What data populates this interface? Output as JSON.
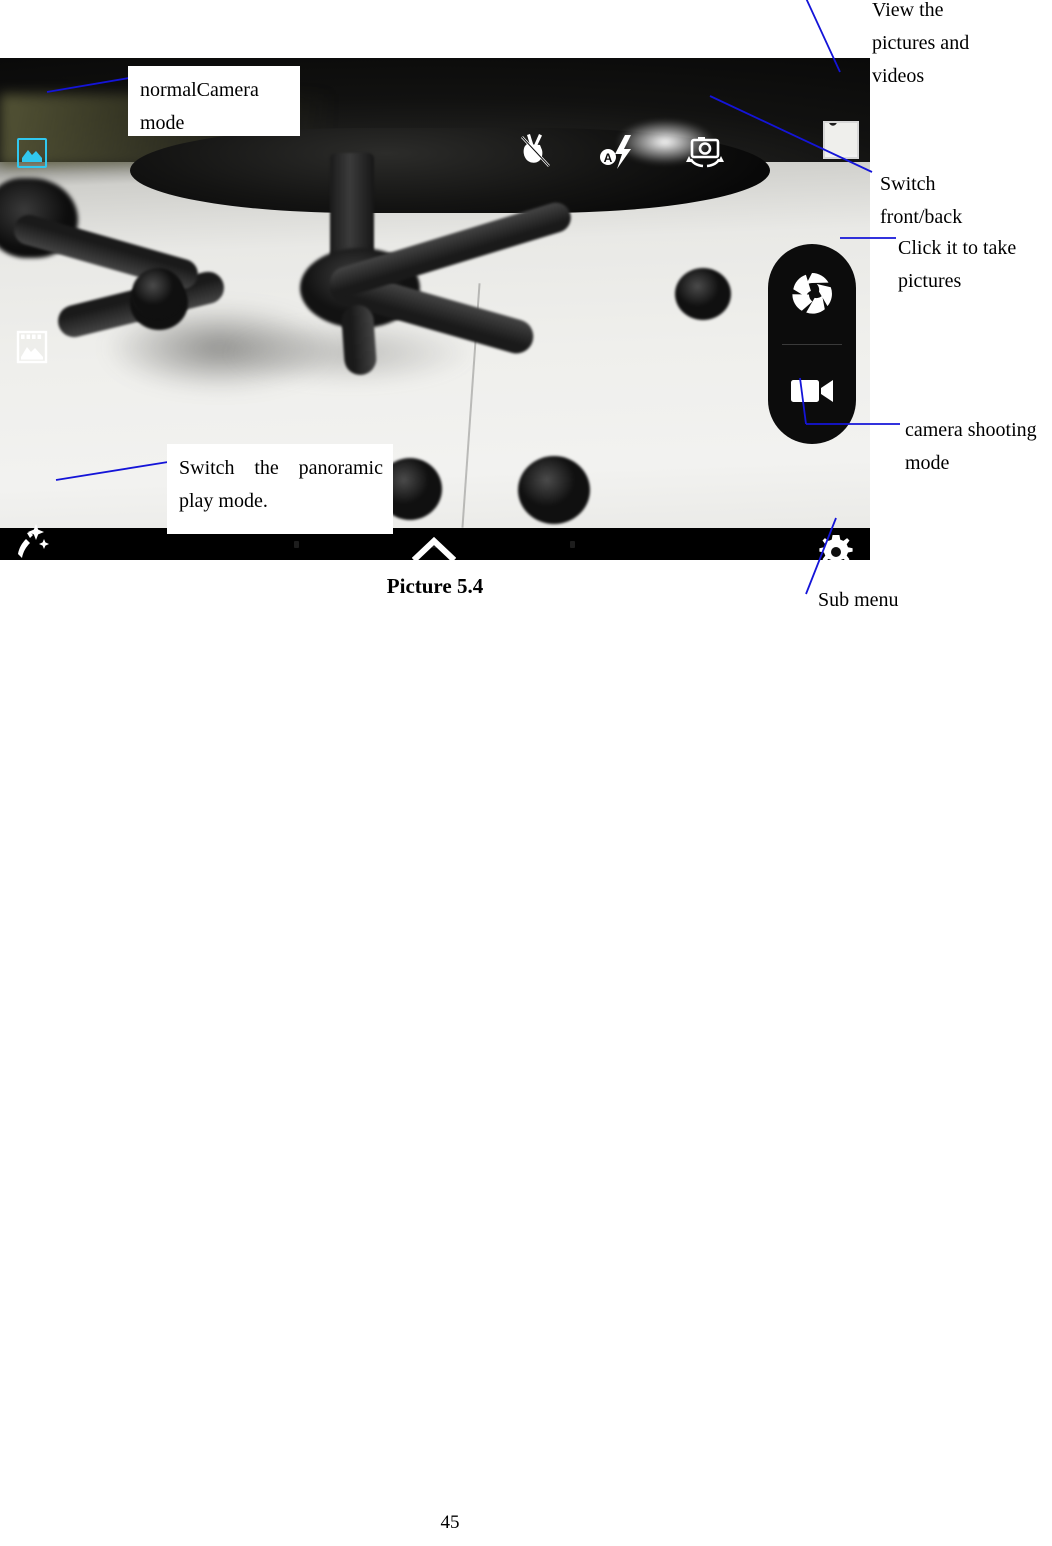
{
  "document": {
    "figure_caption": "Picture 5.4",
    "page_number": "45"
  },
  "callouts": {
    "normal_camera_mode": "normalCamera mode",
    "panoramic_play_mode": "Switch the panoramic play mode."
  },
  "notes": {
    "view_pictures": {
      "line1": "View           the",
      "line2": "pictures       and",
      "line3": "videos"
    },
    "switch_front_back": {
      "line1": "Switch",
      "line2": "front/back"
    },
    "click_to_take": {
      "line1": "Click  it  to  take",
      "line2": "pictures"
    },
    "camera_shooting_mode": {
      "line1": "camera    shooting",
      "line2": "mode"
    },
    "sub_menu": "Sub menu"
  },
  "camera_ui": {
    "icons": {
      "normal_mode": "image-mode-icon",
      "gallery_strip": "filmstrip-gallery-icon",
      "gesture_shot": "hand-gesture-off-icon",
      "flash": "flash-auto-icon",
      "switch_camera": "camera-rotate-icon",
      "thumbnail": "last-photo-thumbnail",
      "magic_wand": "magic-wand-sparkle-icon",
      "expand": "chevron-up-icon",
      "settings": "gear-icon",
      "shutter": "aperture-shutter-icon",
      "video": "video-camera-icon"
    },
    "navbar_dots": 3
  },
  "colors": {
    "accent_cyan": "#31c8ef",
    "leader_blue": "#1414d8",
    "pill_black": "#0c0c0c",
    "navbar_black": "#000000",
    "page_background": "#ffffff"
  }
}
